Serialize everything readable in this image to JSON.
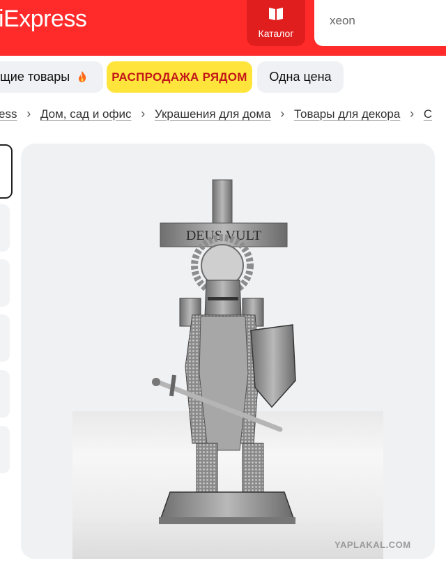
{
  "header": {
    "logo_text": "iExpress",
    "catalog_label": "Каталог",
    "catalog_icon": "book-icon",
    "search_value": "xeon"
  },
  "chips": [
    {
      "label": "щие товары",
      "icon": "fire-icon"
    },
    {
      "label": "РАСПРОДАЖА РЯДОМ"
    },
    {
      "label": "Одна цена"
    }
  ],
  "breadcrumb": [
    "ess",
    "Дом, сад и офис",
    "Украшения для дома",
    "Товары для декора",
    "С"
  ],
  "product_image": {
    "engraving": "DEUS VULT",
    "watermark": "YAPLAKAL.COM"
  },
  "colors": {
    "brand_red": "#ff2b2b",
    "sale_yellow": "#ffe53b",
    "sale_text": "#c2161a"
  }
}
